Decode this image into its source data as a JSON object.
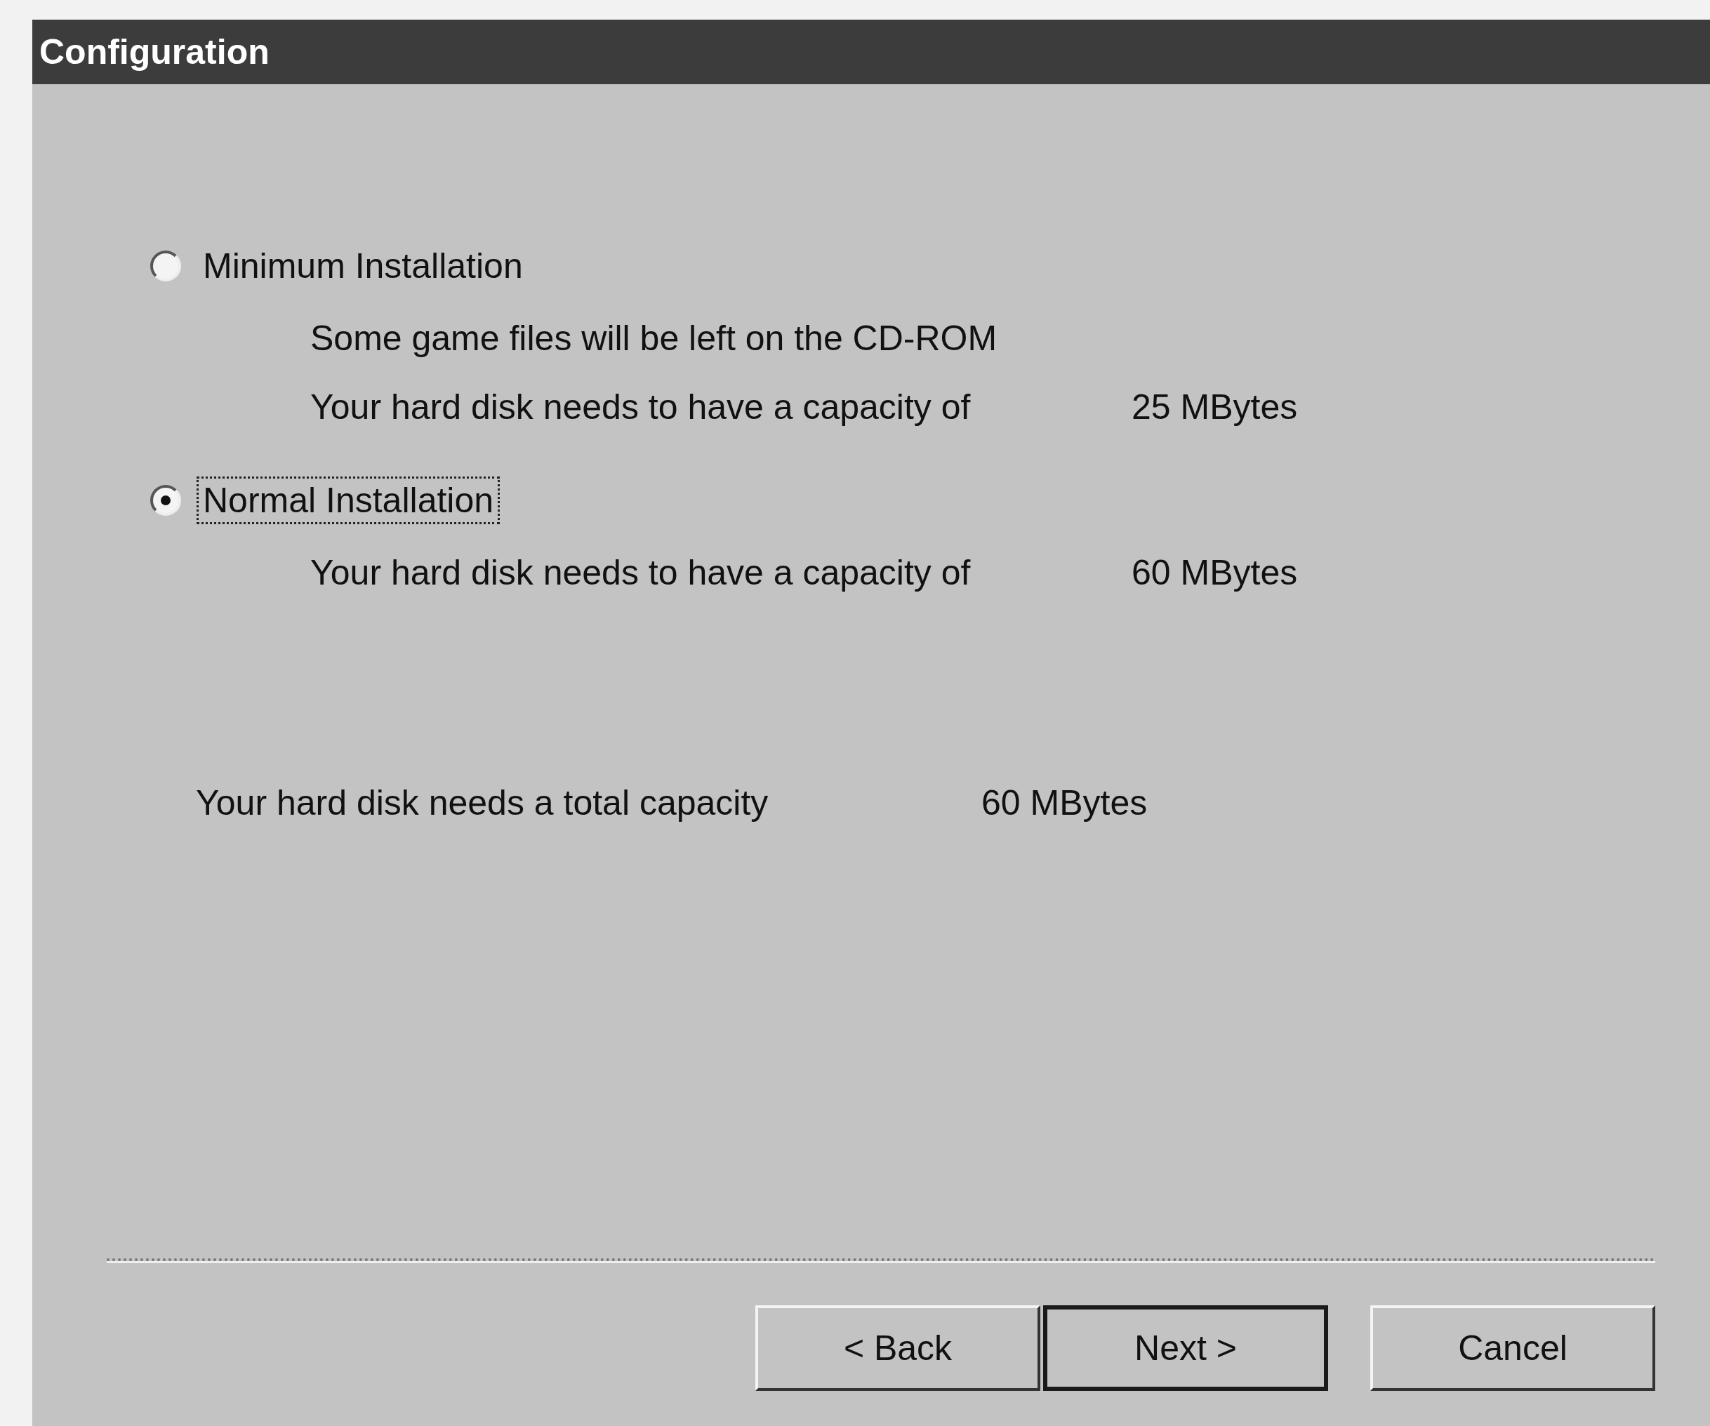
{
  "window": {
    "title": "Configuration"
  },
  "options": [
    {
      "label": "Minimum Installation",
      "selected": false,
      "focused": false,
      "lines": [
        {
          "text": "Some game files will be left on the CD-ROM"
        },
        {
          "text": "Your hard disk needs to have a capacity of",
          "value": "25 MBytes"
        }
      ]
    },
    {
      "label": "Normal Installation",
      "selected": true,
      "focused": true,
      "lines": [
        {
          "text": "Your hard disk needs to have a capacity of",
          "value": "60 MBytes"
        }
      ]
    }
  ],
  "total": {
    "label": "Your hard disk needs a total capacity",
    "value": "60 MBytes"
  },
  "buttons": [
    {
      "label": "< Back",
      "default": false
    },
    {
      "label": "Next >",
      "default": true
    },
    {
      "label": "Cancel",
      "default": false
    }
  ]
}
